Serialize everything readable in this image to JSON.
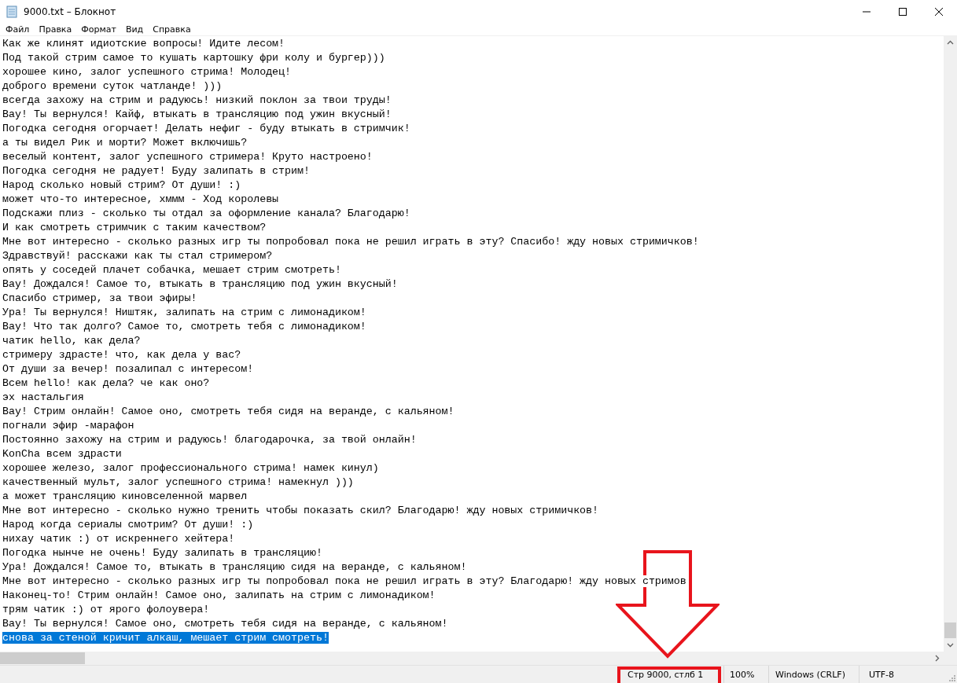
{
  "window": {
    "title": "9000.txt – Блокнот"
  },
  "menu": [
    "Файл",
    "Правка",
    "Формат",
    "Вид",
    "Справка"
  ],
  "lines": [
    {
      "text": "Как же клинят идиотские вопросы! Идите лесом!",
      "selected": false
    },
    {
      "text": "Под такой стрим самое то кушать картошку фри колу и бургер)))",
      "selected": false
    },
    {
      "text": "хорошее кино, залог успешного стрима! Молодец!",
      "selected": false
    },
    {
      "text": "доброго времени суток чатланде! )))",
      "selected": false
    },
    {
      "text": "всегда захожу на стрим и радуюсь! низкий поклон за твои труды!",
      "selected": false
    },
    {
      "text": "Вау! Ты вернулся! Кайф, втыкать в трансляцию под ужин вкусный!",
      "selected": false
    },
    {
      "text": "Погодка сегодня огорчает! Делать нефиг - буду втыкать в стримчик!",
      "selected": false
    },
    {
      "text": "а ты видел Рик и морти? Может включишь?",
      "selected": false
    },
    {
      "text": "веселый контент, залог успешного стримера! Круто настроено!",
      "selected": false
    },
    {
      "text": "Погодка сегодня не радует! Буду залипать в стрим!",
      "selected": false
    },
    {
      "text": "Народ сколько новый стрим? От души! :)",
      "selected": false
    },
    {
      "text": "может что-то интересное, хммм - Ход королевы",
      "selected": false
    },
    {
      "text": "Подскажи плиз - сколько ты отдал за оформление канала? Благодарю!",
      "selected": false
    },
    {
      "text": "И как смотреть стримчик с таким качеством?",
      "selected": false
    },
    {
      "text": "Мне вот интересно - сколько разных игр ты попробовал пока не решил играть в эту? Спасибо! жду новых стримичков!",
      "selected": false
    },
    {
      "text": "Здравствуй! расскажи как ты стал стримером?",
      "selected": false
    },
    {
      "text": "опять у соседей плачет собачка, мешает стрим смотреть!",
      "selected": false
    },
    {
      "text": "Вау! Дождался! Самое то, втыкать в трансляцию под ужин вкусный!",
      "selected": false
    },
    {
      "text": "Спасибо стример, за твои эфиры!",
      "selected": false
    },
    {
      "text": "Ура! Ты вернулся! Ништяк, залипать на стрим с лимонадиком!",
      "selected": false
    },
    {
      "text": "Вау! Что так долго? Самое то, смотреть тебя с лимонадиком!",
      "selected": false
    },
    {
      "text": "чатик hello, как дела?",
      "selected": false
    },
    {
      "text": "стримеру здрасте! что, как дела у вас?",
      "selected": false
    },
    {
      "text": "От души за вечер! позалипал с интересом!",
      "selected": false
    },
    {
      "text": "Всем hello! как дела? че как оно?",
      "selected": false
    },
    {
      "text": "эх настальгия",
      "selected": false
    },
    {
      "text": "Вау! Стрим онлайн! Самое оно, смотреть тебя сидя на веранде, с кальяном!",
      "selected": false
    },
    {
      "text": "погнали эфир -марафон",
      "selected": false
    },
    {
      "text": "Постоянно захожу на стрим и радуюсь! благодарочка, за твой онлайн!",
      "selected": false
    },
    {
      "text": "KonCha всем здрасти",
      "selected": false
    },
    {
      "text": "хорошее железо, залог профессионального стрима! намек кинул)",
      "selected": false
    },
    {
      "text": "качественный мульт, залог успешного стрима! намекнул )))",
      "selected": false
    },
    {
      "text": "а может трансляцию киновселенной марвел",
      "selected": false
    },
    {
      "text": "Мне вот интересно - сколько нужно тренить чтобы показать скил? Благодарю! жду новых стримичков!",
      "selected": false
    },
    {
      "text": "Народ когда сериалы смотрим? От души! :)",
      "selected": false
    },
    {
      "text": "нихау чатик :) от искреннего хейтера!",
      "selected": false
    },
    {
      "text": "Погодка нынче не очень! Буду залипать в трансляцию!",
      "selected": false
    },
    {
      "text": "Ура! Дождался! Самое то, втыкать в трансляцию сидя на веранде, с кальяном!",
      "selected": false
    },
    {
      "text": "Мне вот интересно - сколько разных игр ты попробовал пока не решил играть в эту? Благодарю! жду новых стримов",
      "selected": false
    },
    {
      "text": "Наконец-то! Стрим онлайн! Самое оно, залипать на стрим с лимонадиком!",
      "selected": false
    },
    {
      "text": "трям чатик :) от ярого фолоувера!",
      "selected": false
    },
    {
      "text": "Вау! Ты вернулся! Самое оно, смотреть тебя сидя на веранде, с кальяном!",
      "selected": false
    },
    {
      "text": "снова за стеной кричит алкаш, мешает стрим смотреть!",
      "selected": true
    }
  ],
  "status_bar": {
    "position": "Стр 9000, стлб 1",
    "zoom": "100%",
    "line_endings": "Windows (CRLF)",
    "encoding": "UTF-8"
  }
}
